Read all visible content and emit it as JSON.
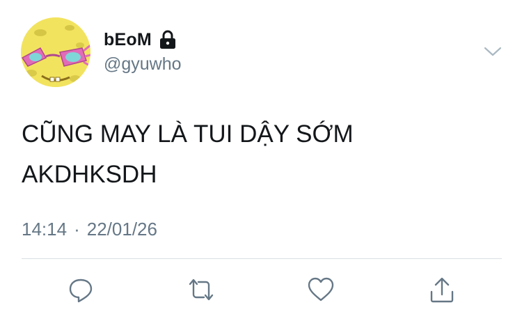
{
  "user": {
    "display_name": "bEoM",
    "handle": "@gyuwho",
    "protected_icon": "lock-icon",
    "avatar_icon": "spongebob-avatar"
  },
  "tweet": {
    "lines": [
      "CŨNG MAY LÀ TUI DẬY SỚM",
      "AKDHKSDH"
    ],
    "time": "14:14",
    "separator": "·",
    "date": "22/01/26"
  },
  "actions": [
    {
      "icon": "reply-icon"
    },
    {
      "icon": "retweet-icon"
    },
    {
      "icon": "like-icon"
    },
    {
      "icon": "share-icon"
    }
  ],
  "menu_icon": "chevron-down-icon",
  "colors": {
    "text": "#14171a",
    "secondary": "#657786",
    "divider": "#dadfe3",
    "icon": "#657786"
  }
}
